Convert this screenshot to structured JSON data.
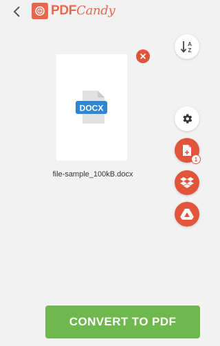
{
  "header": {
    "brand_primary": "PDF",
    "brand_secondary": "Candy",
    "back_icon": "chevron-left-icon"
  },
  "files": [
    {
      "name": "file-sample_100kB.docx",
      "type_label": "DOCX"
    }
  ],
  "actions": {
    "sort_icon": "sort-az-icon",
    "sort_top_letter": "A",
    "sort_bottom_letter": "Z",
    "settings_icon": "gear-icon",
    "add_file_icon": "add-file-icon",
    "add_file_count": "1",
    "dropbox_icon": "dropbox-icon",
    "gdrive_icon": "google-drive-icon"
  },
  "convert_button": {
    "label": "CONVERT TO PDF"
  },
  "colors": {
    "brand": "#e8674f",
    "accent_red": "#e1553a",
    "convert_green": "#6fb84d",
    "background": "#f2f2f2",
    "docx_blue": "#2f86d6"
  }
}
